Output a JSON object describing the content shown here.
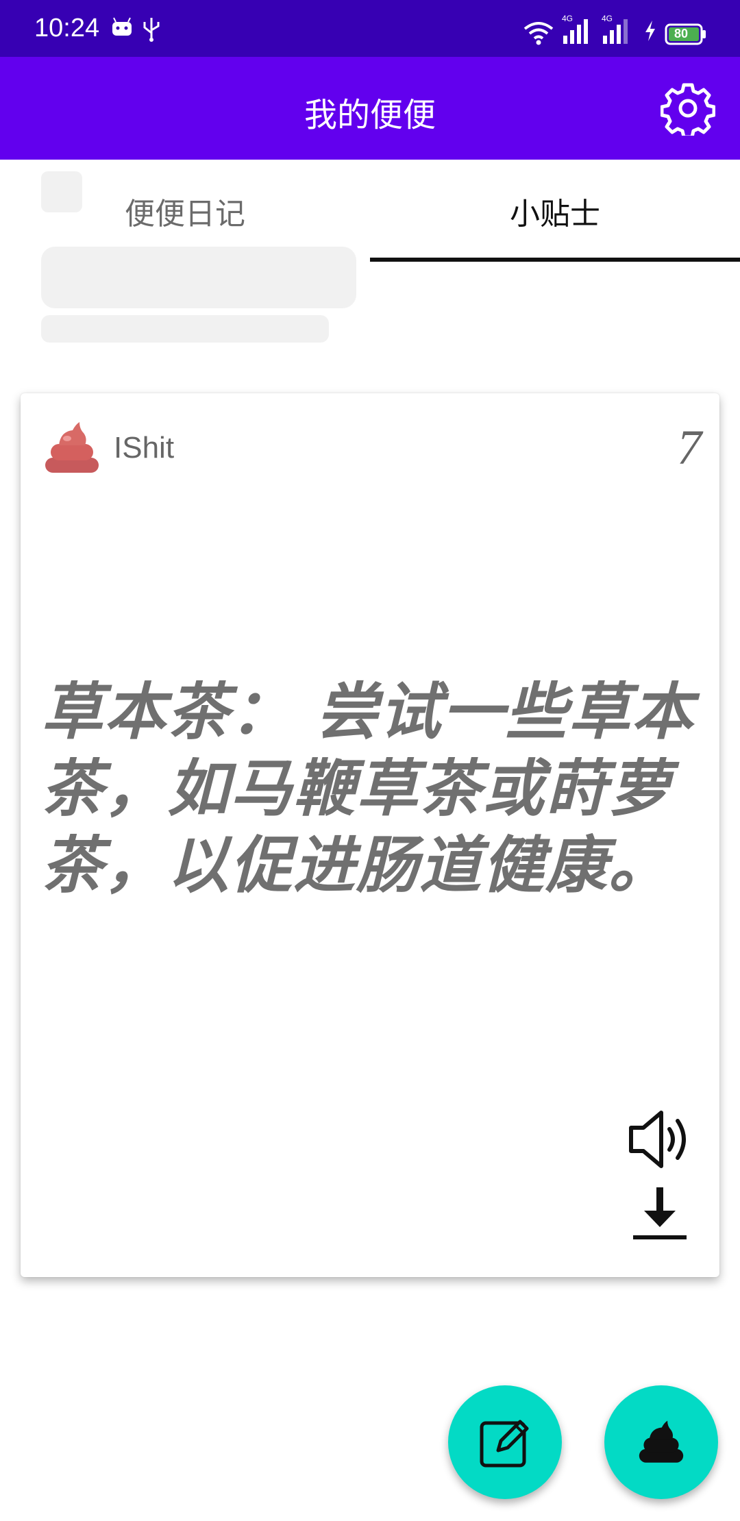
{
  "status_bar": {
    "time": "10:24",
    "battery": "80",
    "network_1": "4G",
    "network_2": "4G",
    "icons": [
      "android-icon",
      "usb-icon",
      "wifi-icon",
      "signal-icon",
      "signal-icon",
      "charging-icon",
      "battery-icon"
    ]
  },
  "app_bar": {
    "title": "我的便便",
    "settings_icon": "gear-icon"
  },
  "tabs": [
    {
      "label": "便便日记",
      "selected": false
    },
    {
      "label": "小贴士",
      "selected": true
    }
  ],
  "card": {
    "brand_name": "IShit",
    "brand_icon": "poop-icon",
    "tip_number": "7",
    "tip_text": "草本茶： 尝试一些草本茶，如马鞭草茶或莳萝茶，以促进肠道健康。",
    "actions": [
      "speaker-icon",
      "download-icon"
    ]
  },
  "fabs": [
    {
      "icon": "edit-icon"
    },
    {
      "icon": "poop-icon"
    }
  ],
  "colors": {
    "status_bar": "#3700b3",
    "app_bar": "#6200ee",
    "fab": "#03dac5",
    "brand_logo": "#d4605e"
  }
}
